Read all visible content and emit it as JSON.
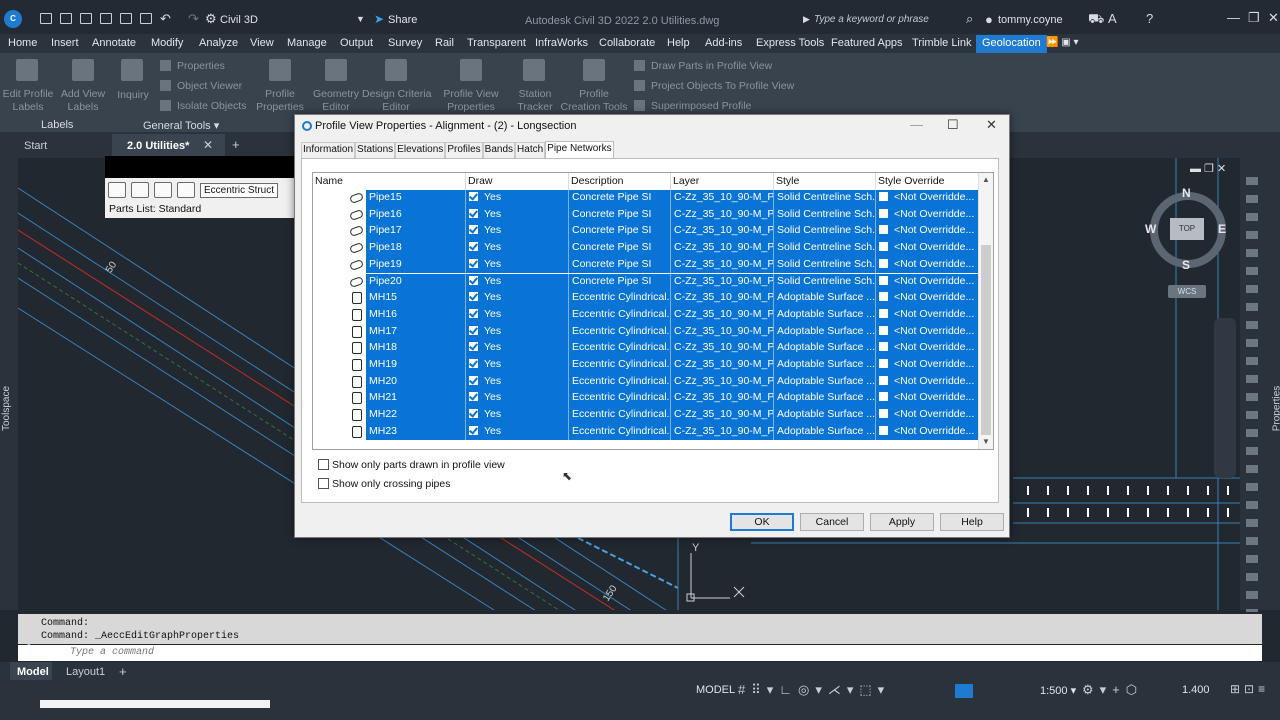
{
  "app": {
    "workspace": "Civil 3D",
    "share_label": "Share",
    "title": "Autodesk Civil 3D 2022    2.0 Utilities.dwg",
    "search_placeholder": "Type a keyword or phrase",
    "user": "tommy.coyne"
  },
  "menu": [
    "Home",
    "Insert",
    "Annotate",
    "Modify",
    "Analyze",
    "View",
    "Manage",
    "Output",
    "Survey",
    "Rail",
    "Transparent",
    "InfraWorks",
    "Collaborate",
    "Help",
    "Add-ins",
    "Express Tools",
    "Featured Apps",
    "Trimble Link",
    "Geolocation"
  ],
  "menu_active": "Geolocation",
  "ribbon": {
    "edit_profile_labels": "Edit Profile\nLabels",
    "add_view_labels": "Add View\nLabels",
    "inquiry": "Inquiry",
    "properties": "Properties",
    "object_viewer": "Object Viewer",
    "isolate_objects": "Isolate Objects",
    "profile_properties": "Profile\nProperties",
    "geometry_editor": "Geometry\nEditor",
    "design_criteria_editor": "Design Criteria\nEditor",
    "profile_view_properties": "Profile View\nProperties",
    "station_tracker": "Station\nTracker",
    "profile_creation_tools": "Profile\nCreation Tools",
    "draw_parts": "Draw Parts in Profile View",
    "project_objects": "Project Objects To Profile View",
    "superimposed": "Superimposed Profile",
    "panel_labels": "Labels",
    "panel_general": "General Tools"
  },
  "doctabs": {
    "start": "Start",
    "active": "2.0 Utilities*"
  },
  "popup": {
    "dropdown": "Eccentric Struct",
    "parts_list": "Parts List: Standard"
  },
  "canvas": {
    "north": "N",
    "south": "S",
    "west": "W",
    "east": "E",
    "top": "TOP",
    "wcs": "WCS",
    "station_50": "50",
    "station_150": "150",
    "y_axis": "Y"
  },
  "side": {
    "toolspace": "Toolspace",
    "properties": "Properties"
  },
  "dialog": {
    "title": "Profile View Properties - Alignment - (2) - Longsection",
    "tabs": [
      "Information",
      "Stations",
      "Elevations",
      "Profiles",
      "Bands",
      "Hatch",
      "Pipe Networks"
    ],
    "active_tab": "Pipe Networks",
    "columns": [
      "Name",
      "Draw",
      "Description",
      "Layer",
      "Style",
      "Style Override"
    ],
    "rows": [
      {
        "type": "pipe",
        "name": "Pipe15",
        "draw": "Yes",
        "description": "Concrete Pipe SI",
        "layer": "C-Zz_35_10_90-M_P...",
        "style": "Solid Centreline Sch...",
        "override": "<Not Overridde..."
      },
      {
        "type": "pipe",
        "name": "Pipe16",
        "draw": "Yes",
        "description": "Concrete Pipe SI",
        "layer": "C-Zz_35_10_90-M_P...",
        "style": "Solid Centreline Sch...",
        "override": "<Not Overridde..."
      },
      {
        "type": "pipe",
        "name": "Pipe17",
        "draw": "Yes",
        "description": "Concrete Pipe SI",
        "layer": "C-Zz_35_10_90-M_P...",
        "style": "Solid Centreline Sch...",
        "override": "<Not Overridde..."
      },
      {
        "type": "pipe",
        "name": "Pipe18",
        "draw": "Yes",
        "description": "Concrete Pipe SI",
        "layer": "C-Zz_35_10_90-M_P...",
        "style": "Solid Centreline Sch...",
        "override": "<Not Overridde..."
      },
      {
        "type": "pipe",
        "name": "Pipe19",
        "draw": "Yes",
        "description": "Concrete Pipe SI",
        "layer": "C-Zz_35_10_90-M_P...",
        "style": "Solid Centreline Sch...",
        "override": "<Not Overridde..."
      },
      {
        "type": "pipe",
        "name": "Pipe20",
        "draw": "Yes",
        "description": "Concrete Pipe SI",
        "layer": "C-Zz_35_10_90-M_P...",
        "style": "Solid Centreline Sch...",
        "override": "<Not Overridde..."
      },
      {
        "type": "structure",
        "name": "MH15",
        "draw": "Yes",
        "description": "Eccentric Cylindrical...",
        "layer": "C-Zz_35_10_90-M_P...",
        "style": "Adoptable Surface ...",
        "override": "<Not Overridde..."
      },
      {
        "type": "structure",
        "name": "MH16",
        "draw": "Yes",
        "description": "Eccentric Cylindrical...",
        "layer": "C-Zz_35_10_90-M_P...",
        "style": "Adoptable Surface ...",
        "override": "<Not Overridde..."
      },
      {
        "type": "structure",
        "name": "MH17",
        "draw": "Yes",
        "description": "Eccentric Cylindrical...",
        "layer": "C-Zz_35_10_90-M_P...",
        "style": "Adoptable Surface ...",
        "override": "<Not Overridde..."
      },
      {
        "type": "structure",
        "name": "MH18",
        "draw": "Yes",
        "description": "Eccentric Cylindrical...",
        "layer": "C-Zz_35_10_90-M_P...",
        "style": "Adoptable Surface ...",
        "override": "<Not Overridde..."
      },
      {
        "type": "structure",
        "name": "MH19",
        "draw": "Yes",
        "description": "Eccentric Cylindrical...",
        "layer": "C-Zz_35_10_90-M_P...",
        "style": "Adoptable Surface ...",
        "override": "<Not Overridde..."
      },
      {
        "type": "structure",
        "name": "MH20",
        "draw": "Yes",
        "description": "Eccentric Cylindrical...",
        "layer": "C-Zz_35_10_90-M_P...",
        "style": "Adoptable Surface ...",
        "override": "<Not Overridde..."
      },
      {
        "type": "structure",
        "name": "MH21",
        "draw": "Yes",
        "description": "Eccentric Cylindrical...",
        "layer": "C-Zz_35_10_90-M_P...",
        "style": "Adoptable Surface ...",
        "override": "<Not Overridde..."
      },
      {
        "type": "structure",
        "name": "MH22",
        "draw": "Yes",
        "description": "Eccentric Cylindrical...",
        "layer": "C-Zz_35_10_90-M_P...",
        "style": "Adoptable Surface ...",
        "override": "<Not Overridde..."
      },
      {
        "type": "structure",
        "name": "MH23",
        "draw": "Yes",
        "description": "Eccentric Cylindrical...",
        "layer": "C-Zz_35_10_90-M_P...",
        "style": "Adoptable Surface ...",
        "override": "<Not Overridde..."
      }
    ],
    "opt_profile_only": "Show only parts drawn in profile view",
    "opt_crossing": "Show only crossing pipes",
    "ok": "OK",
    "cancel": "Cancel",
    "apply": "Apply",
    "help": "Help"
  },
  "command": {
    "line1": "Command:",
    "line2": "Command: _AeccEditGraphProperties",
    "placeholder": "Type a command"
  },
  "status": {
    "model_tab": "Model",
    "layout_tab": "Layout1",
    "model": "MODEL",
    "scale": "1:500",
    "value": "1.400"
  },
  "colors": {
    "selection": "#0a74d6",
    "accent": "#1f7ad1",
    "canvas": "#212830"
  }
}
